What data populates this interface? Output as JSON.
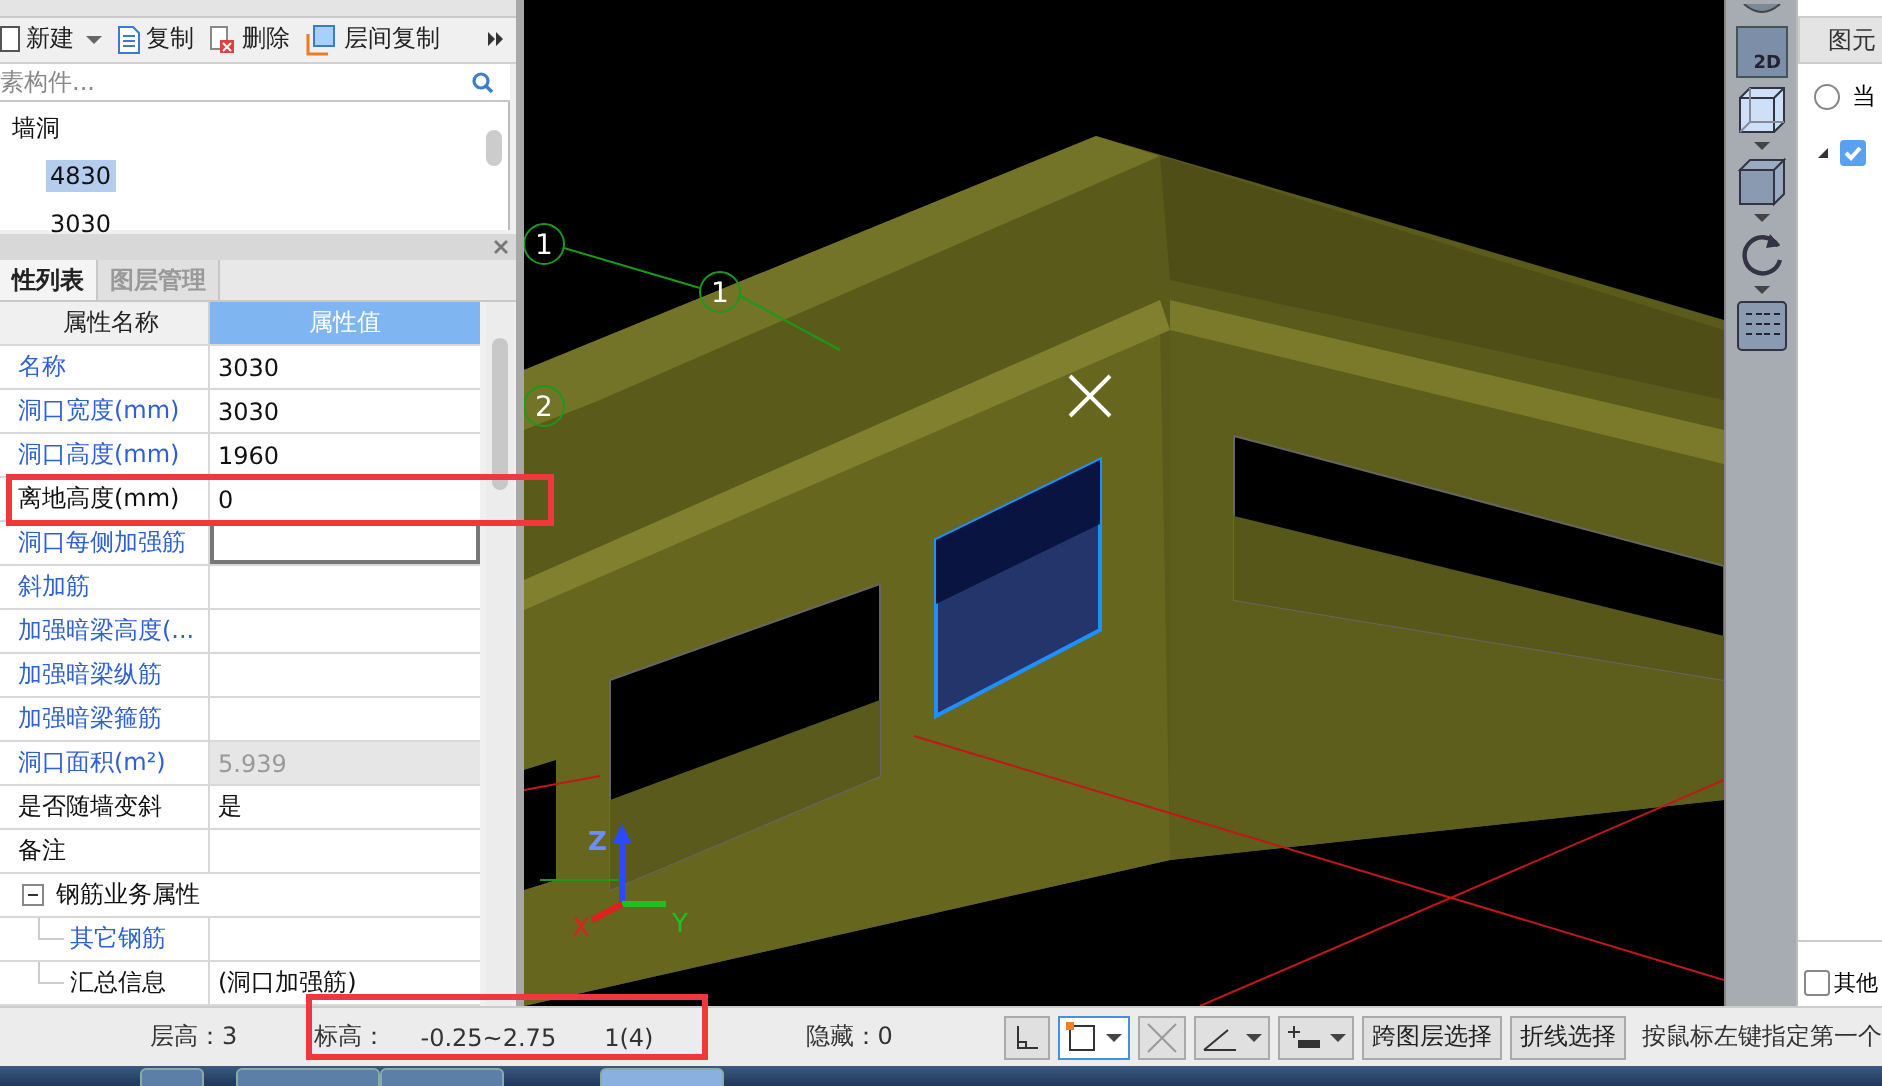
{
  "left_panel": {
    "toolbar": [
      {
        "label": "新建",
        "kind": "dropdown"
      },
      {
        "label": "复制",
        "kind": "copy"
      },
      {
        "label": "删除",
        "kind": "delete"
      },
      {
        "label": "层间复制",
        "kind": "floor-copy"
      }
    ],
    "search": {
      "placeholder": "素构件..."
    },
    "tree": [
      {
        "label": "墙洞",
        "children": [
          {
            "label": "4830",
            "selected": true
          },
          {
            "label": "3030",
            "selected": false
          }
        ]
      }
    ],
    "tabs": [
      {
        "label": "性列表",
        "selected": true
      },
      {
        "label": "图层管理",
        "selected": false
      }
    ],
    "properties": {
      "columns": [
        "属性名称",
        "属性值"
      ],
      "rows": [
        {
          "kind": "field",
          "name": "名称",
          "value": "3030",
          "public": true,
          "selected": false,
          "disabled": false
        },
        {
          "kind": "field",
          "name": "洞口宽度(mm)",
          "value": "3030",
          "public": true,
          "selected": false,
          "disabled": false
        },
        {
          "kind": "field",
          "name": "洞口高度(mm)",
          "value": "1960",
          "public": true,
          "selected": false,
          "disabled": false
        },
        {
          "kind": "field",
          "name": "离地高度(mm)",
          "value": "0",
          "public": false,
          "selected": false,
          "disabled": false
        },
        {
          "kind": "field",
          "name": "洞口每侧加强筋",
          "public": true,
          "selected": true,
          "disabled": false
        },
        {
          "kind": "field",
          "name": "斜加筋",
          "public": true,
          "selected": false,
          "disabled": false
        },
        {
          "kind": "field",
          "name": "加强暗梁高度(...",
          "public": true,
          "selected": false,
          "disabled": false
        },
        {
          "kind": "field",
          "name": "加强暗梁纵筋",
          "public": true,
          "selected": false,
          "disabled": false
        },
        {
          "kind": "field",
          "name": "加强暗梁箍筋",
          "public": true,
          "selected": false,
          "disabled": false
        },
        {
          "kind": "field",
          "name": "洞口面积(m²)",
          "value": "5.939",
          "public": true,
          "selected": false,
          "disabled": true
        },
        {
          "kind": "field",
          "name": "是否随墙变斜",
          "value": "是",
          "public": false,
          "selected": false,
          "disabled": false
        },
        {
          "kind": "field",
          "name": "备注",
          "public": false,
          "selected": false,
          "disabled": false
        },
        {
          "kind": "group",
          "name": "钢筋业务属性",
          "expanded": true,
          "public": false,
          "selected": false,
          "disabled": false
        },
        {
          "kind": "child",
          "name": "其它钢筋",
          "public": true,
          "selected": false,
          "disabled": false
        },
        {
          "kind": "child",
          "name": "汇总信息",
          "value": "(洞口加强筋)",
          "public": false,
          "selected": false,
          "disabled": false
        }
      ]
    }
  },
  "viewport": {
    "axis_markers": [
      {
        "label": "1"
      },
      {
        "label": "1"
      },
      {
        "label": "2"
      }
    ],
    "axes": {
      "x": "X",
      "y": "Y",
      "z": "Z"
    }
  },
  "right_toolbar": {
    "view_2d": "2D"
  },
  "right_panel": {
    "tab": "图元",
    "radio": {
      "label": "当",
      "selected": false
    },
    "tree_checkbox": {
      "checked": true
    },
    "bottom_checkbox": {
      "label": "其他",
      "checked": false
    }
  },
  "status_bar": {
    "floor_height": "层高：3",
    "elevation_label": "标高：",
    "elevation": "-0.25~2.75",
    "count": "1(4)",
    "hidden": "隐藏：0",
    "buttons": [
      "跨图层选择",
      "折线选择"
    ],
    "hint": "按鼠标左键指定第一个"
  }
}
